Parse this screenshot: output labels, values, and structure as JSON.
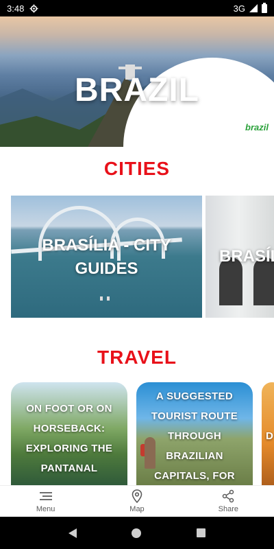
{
  "status_bar": {
    "time": "3:48",
    "network": "3G"
  },
  "hero": {
    "title": "BRAZIL",
    "logo_text": "brazil"
  },
  "sections": {
    "cities_heading": "CITIES",
    "travel_heading": "TRAVEL"
  },
  "cities": [
    {
      "label": "BRASÍLIA - CITY GUIDES"
    },
    {
      "label": "BRASÍL"
    }
  ],
  "travel": [
    {
      "label": "ON FOOT OR ON HORSEBACK: EXPLORING THE PANTANAL"
    },
    {
      "label": "A SUGGESTED TOURIST ROUTE THROUGH BRAZILIAN CAPITALS, FOR"
    },
    {
      "label": "D"
    }
  ],
  "bottom_nav": {
    "menu_label": "Menu",
    "map_label": "Map",
    "share_label": "Share"
  },
  "colors": {
    "accent_red": "#e8111a",
    "logo_green": "#2aa13a"
  },
  "icons": [
    "gear-icon",
    "signal-icon",
    "battery-icon",
    "menu-icon",
    "map-pin-icon",
    "share-icon",
    "back-icon",
    "home-icon",
    "recents-icon"
  ]
}
